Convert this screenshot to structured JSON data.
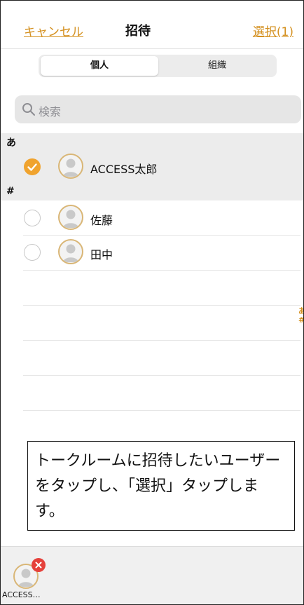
{
  "nav": {
    "cancel_label": "キャンセル",
    "title": "招待",
    "select_label": "選択(1)"
  },
  "segment": {
    "options": [
      "個人",
      "組織"
    ],
    "selected": "個人"
  },
  "search": {
    "placeholder": "検索"
  },
  "sections": [
    {
      "header": "あ",
      "items": [
        {
          "name": "ACCESS太郎",
          "selected": true
        }
      ]
    },
    {
      "header": "#",
      "items": [
        {
          "name": "佐藤",
          "selected": false
        },
        {
          "name": "田中",
          "selected": false
        }
      ]
    }
  ],
  "index": [
    "あ",
    "#"
  ],
  "note": {
    "text": "トークルームに招待したいユーザーをタップし、「選択」タップします。"
  },
  "tray": {
    "selected_label": "ACCESS…"
  },
  "colors": {
    "accent": "#d4901f",
    "check": "#f0a32e",
    "remove": "#e5413b"
  },
  "icons": {
    "search": "search-icon",
    "check": "check-icon",
    "avatar": "person-avatar-icon",
    "remove": "remove-icon"
  }
}
